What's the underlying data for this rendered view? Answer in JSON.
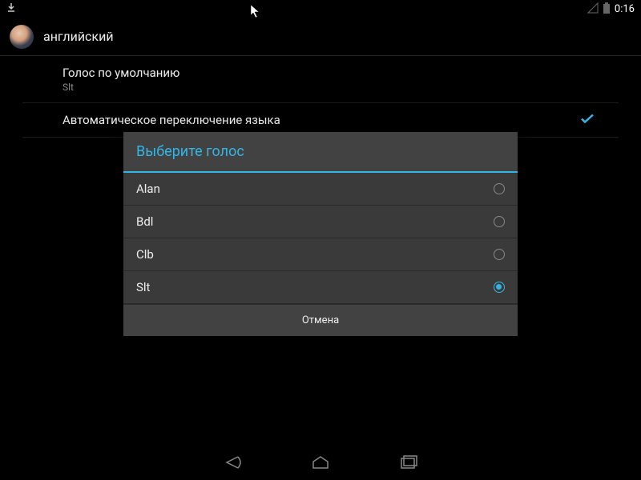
{
  "status": {
    "time": "0:16"
  },
  "header": {
    "title": "английский"
  },
  "settings": {
    "default_voice": {
      "title": "Голос по умолчанию",
      "value": "Slt"
    },
    "auto_switch": {
      "title": "Автоматическое переключение языка",
      "enabled": true
    }
  },
  "dialog": {
    "title": "Выберите голос",
    "options": [
      {
        "label": "Alan",
        "selected": false
      },
      {
        "label": "Bdl",
        "selected": false
      },
      {
        "label": "Clb",
        "selected": false
      },
      {
        "label": "Slt",
        "selected": true
      }
    ],
    "cancel": "Отмена"
  },
  "colors": {
    "accent": "#33b5e5"
  }
}
